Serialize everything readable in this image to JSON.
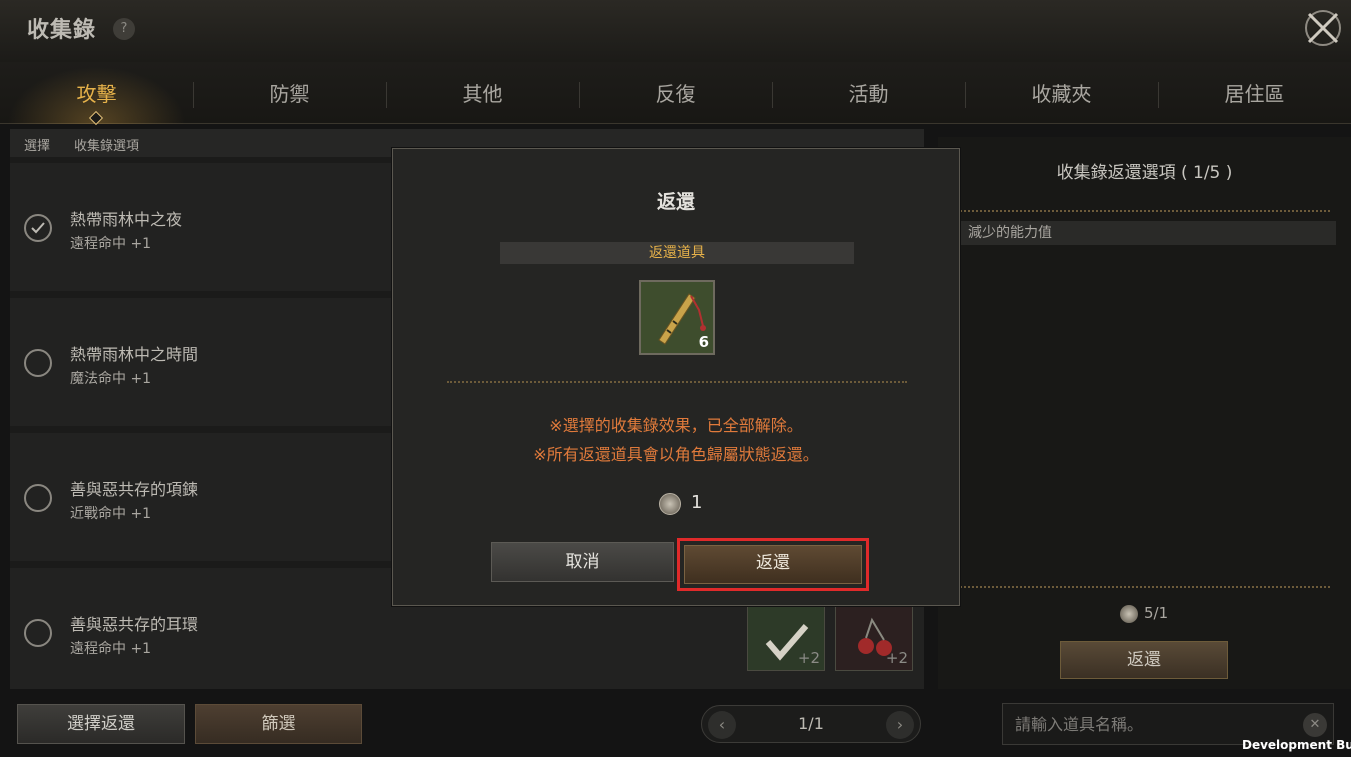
{
  "header": {
    "title": "收集錄",
    "help": "?"
  },
  "tabs": [
    {
      "label": "攻擊",
      "active": true
    },
    {
      "label": "防禦",
      "active": false
    },
    {
      "label": "其他",
      "active": false
    },
    {
      "label": "反復",
      "active": false
    },
    {
      "label": "活動",
      "active": false
    },
    {
      "label": "收藏夾",
      "active": false
    },
    {
      "label": "居住區",
      "active": false
    }
  ],
  "list": {
    "header": {
      "select": "選擇",
      "option": "收集錄選項"
    },
    "items": [
      {
        "name": "熱帶雨林中之夜",
        "stat": "遠程命中 +1",
        "checked": true
      },
      {
        "name": "熱帶雨林中之時間",
        "stat": "魔法命中 +1",
        "checked": false
      },
      {
        "name": "善與惡共存的項鍊",
        "stat": "近戰命中 +1",
        "checked": false
      },
      {
        "name": "善與惡共存的耳環",
        "stat": "遠程命中 +1",
        "checked": false
      }
    ],
    "thumbs": [
      "+2",
      "+2"
    ]
  },
  "right_panel": {
    "title": "收集錄返還選項 ( 1/5 )",
    "reduced_label": "減少的能力值",
    "count": "5/1",
    "button": "返還"
  },
  "bottom": {
    "select_return": "選擇返還",
    "filter": "篩選",
    "pager": "1/1",
    "search_placeholder": "請輸入道具名稱。",
    "dev_build": "Development Build"
  },
  "modal": {
    "title": "返還",
    "subtitle": "返還道具",
    "item_count": "6",
    "msg1": "※選擇的收集錄效果，已全部解除。",
    "msg2": "※所有返還道具會以角色歸屬狀態返還。",
    "cost": "1",
    "cancel": "取消",
    "confirm": "返還"
  },
  "colors": {
    "accent": "#e6b24a",
    "warning": "#e07a3b",
    "highlight": "#e02a2a"
  }
}
